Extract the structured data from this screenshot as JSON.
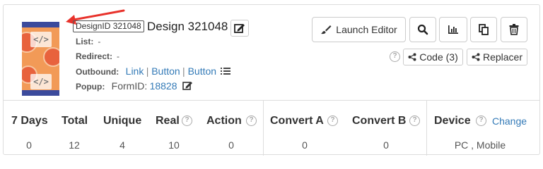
{
  "design": {
    "id_badge": "DesignID 321048",
    "name": "Design 321048"
  },
  "meta": {
    "list_label": "List:",
    "list_value": "-",
    "redirect_label": "Redirect:",
    "redirect_value": "-",
    "outbound_label": "Outbound:",
    "outbound_links": [
      "Link",
      "Button",
      "Button"
    ],
    "popup_label": "Popup:",
    "popup_form_prefix": "FormID:",
    "popup_form_id": "18828"
  },
  "toolbar": {
    "launch_editor": "Launch Editor",
    "code_label": "Code (3)",
    "replacer_label": "Replacer"
  },
  "stats": {
    "headers": [
      "7 Days",
      "Total",
      "Unique",
      "Real",
      "Action",
      "Convert A",
      "Convert B",
      "Device"
    ],
    "values": [
      "0",
      "12",
      "4",
      "10",
      "0",
      "0",
      "0",
      "PC , Mobile"
    ],
    "change_label": "Change"
  },
  "thumbnail": {
    "code_glyph": "</>"
  },
  "colors": {
    "link": "#337ab7",
    "arrow": "#e8322b",
    "border": "#dddddd"
  }
}
